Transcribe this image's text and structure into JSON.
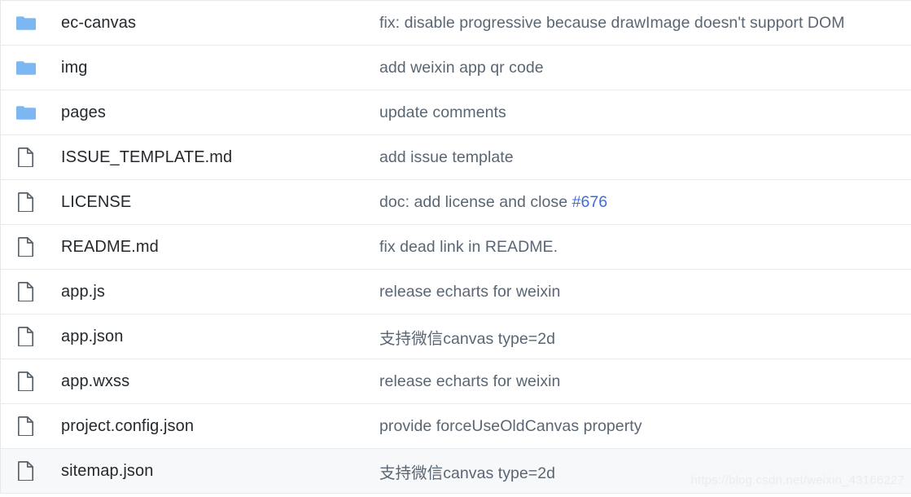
{
  "listing": {
    "icon_names": {
      "folder": "folder-icon",
      "file": "file-icon"
    },
    "colors": {
      "folder_blue": "#7cb7f2",
      "file_gray": "#586069",
      "link_blue": "#3b6ddb",
      "row_highlight": "#f6f8fa",
      "border": "#e8eaee",
      "name_text": "#24292e",
      "message_text": "#5a6673"
    },
    "rows": [
      {
        "type": "folder",
        "name": "ec-canvas",
        "message": "fix: disable progressive because drawImage doesn't support DOM",
        "highlighted": false
      },
      {
        "type": "folder",
        "name": "img",
        "message": "add weixin app qr code",
        "highlighted": false
      },
      {
        "type": "folder",
        "name": "pages",
        "message": "update comments",
        "highlighted": false
      },
      {
        "type": "file",
        "name": "ISSUE_TEMPLATE.md",
        "message": "add issue template",
        "highlighted": false
      },
      {
        "type": "file",
        "name": "LICENSE",
        "message": "doc: add license and ",
        "message_abbr": "close",
        "message_link": "#676",
        "highlighted": false
      },
      {
        "type": "file",
        "name": "README.md",
        "message": "fix dead link in README.",
        "highlighted": false
      },
      {
        "type": "file",
        "name": "app.js",
        "message": "release echarts for weixin",
        "highlighted": false
      },
      {
        "type": "file",
        "name": "app.json",
        "message": "支持微信canvas type=2d",
        "highlighted": false
      },
      {
        "type": "file",
        "name": "app.wxss",
        "message": "release echarts for weixin",
        "highlighted": false
      },
      {
        "type": "file",
        "name": "project.config.json",
        "message": "provide forceUseOldCanvas property",
        "highlighted": false
      },
      {
        "type": "file",
        "name": "sitemap.json",
        "message": "支持微信canvas type=2d",
        "highlighted": true
      }
    ]
  },
  "watermark": {
    "text": "https://blog.csdn.net/weixin_43166227"
  }
}
